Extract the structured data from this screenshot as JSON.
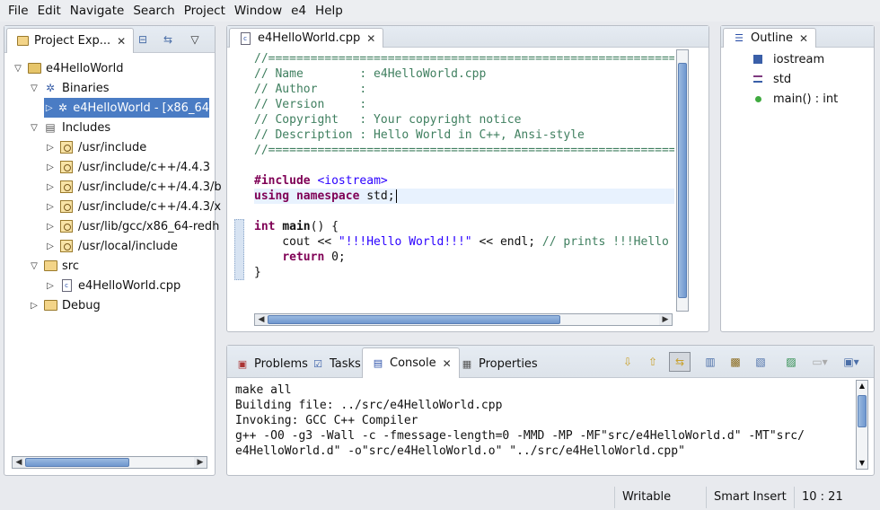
{
  "menu": [
    "File",
    "Edit",
    "Navigate",
    "Search",
    "Project",
    "Window",
    "e4",
    "Help"
  ],
  "project_explorer": {
    "title": "Project Exp...",
    "tree": [
      {
        "label": "e4HelloWorld",
        "depth": 0,
        "twisty": "open",
        "icon": "project-icon"
      },
      {
        "label": "Binaries",
        "depth": 1,
        "twisty": "open",
        "icon": "binaries-icon"
      },
      {
        "label": "e4HelloWorld - [x86_64",
        "depth": 2,
        "twisty": "closed",
        "icon": "binary-icon",
        "selected": true
      },
      {
        "label": "Includes",
        "depth": 1,
        "twisty": "open",
        "icon": "includes-icon"
      },
      {
        "label": "/usr/include",
        "depth": 2,
        "twisty": "closed",
        "icon": "include-folder-icon"
      },
      {
        "label": "/usr/include/c++/4.4.3",
        "depth": 2,
        "twisty": "closed",
        "icon": "include-folder-icon"
      },
      {
        "label": "/usr/include/c++/4.4.3/b",
        "depth": 2,
        "twisty": "closed",
        "icon": "include-folder-icon"
      },
      {
        "label": "/usr/include/c++/4.4.3/x",
        "depth": 2,
        "twisty": "closed",
        "icon": "include-folder-icon"
      },
      {
        "label": "/usr/lib/gcc/x86_64-redh",
        "depth": 2,
        "twisty": "closed",
        "icon": "include-folder-icon"
      },
      {
        "label": "/usr/local/include",
        "depth": 2,
        "twisty": "closed",
        "icon": "include-folder-icon"
      },
      {
        "label": "src",
        "depth": 1,
        "twisty": "open",
        "icon": "source-folder-icon"
      },
      {
        "label": "e4HelloWorld.cpp",
        "depth": 2,
        "twisty": "closed",
        "icon": "cpp-file-icon"
      },
      {
        "label": "Debug",
        "depth": 1,
        "twisty": "closed",
        "icon": "folder-icon"
      }
    ]
  },
  "editor": {
    "tab_label": "e4HelloWorld.cpp",
    "lines": [
      {
        "parts": [
          {
            "t": "//=======================================================================",
            "c": "cm"
          }
        ]
      },
      {
        "parts": [
          {
            "t": "// Name        : e4HelloWorld.cpp",
            "c": "cm"
          }
        ]
      },
      {
        "parts": [
          {
            "t": "// Author      :",
            "c": "cm"
          }
        ]
      },
      {
        "parts": [
          {
            "t": "// Version     :",
            "c": "cm"
          }
        ]
      },
      {
        "parts": [
          {
            "t": "// Copyright   : Your copyright notice",
            "c": "cm"
          }
        ]
      },
      {
        "parts": [
          {
            "t": "// Description : Hello World in C++, Ansi-style",
            "c": "cm"
          }
        ]
      },
      {
        "parts": [
          {
            "t": "//=======================================================================",
            "c": "cm"
          }
        ]
      },
      {
        "parts": []
      },
      {
        "parts": [
          {
            "t": "#include ",
            "c": "kw"
          },
          {
            "t": "<iostream>",
            "c": "str"
          }
        ]
      },
      {
        "parts": [
          {
            "t": "using namespace",
            "c": "kw"
          },
          {
            "t": " std;",
            "c": ""
          }
        ],
        "current": true
      },
      {
        "parts": []
      },
      {
        "parts": [
          {
            "t": "int",
            "c": "kw"
          },
          {
            "t": " ",
            "c": ""
          },
          {
            "t": "main",
            "c": "b"
          },
          {
            "t": "() {",
            "c": ""
          }
        ]
      },
      {
        "parts": [
          {
            "t": "    cout << ",
            "c": ""
          },
          {
            "t": "\"!!!Hello World!!!\"",
            "c": "str"
          },
          {
            "t": " << endl; ",
            "c": ""
          },
          {
            "t": "// prints !!!Hello World!!!",
            "c": "cm"
          }
        ]
      },
      {
        "parts": [
          {
            "t": "    ",
            "c": ""
          },
          {
            "t": "return",
            "c": "kw"
          },
          {
            "t": " 0;",
            "c": ""
          }
        ]
      },
      {
        "parts": [
          {
            "t": "}",
            "c": ""
          }
        ]
      }
    ]
  },
  "outline": {
    "title": "Outline",
    "items": [
      {
        "label": "iostream",
        "icon": "include-icon"
      },
      {
        "label": "std",
        "icon": "namespace-icon"
      },
      {
        "label": "main() : int",
        "icon": "function-icon"
      }
    ]
  },
  "console": {
    "tabs": [
      {
        "label": "Problems",
        "icon": "problems-icon"
      },
      {
        "label": "Tasks",
        "icon": "tasks-icon"
      },
      {
        "label": "Console",
        "icon": "console-icon",
        "active": true
      },
      {
        "label": "Properties",
        "icon": "properties-icon"
      }
    ],
    "lines": [
      "",
      "make all",
      "Building file: ../src/e4HelloWorld.cpp",
      "Invoking: GCC C++ Compiler",
      "g++ -O0 -g3 -Wall -c -fmessage-length=0 -MMD -MP -MF\"src/e4HelloWorld.d\" -MT\"src/",
      "e4HelloWorld.d\" -o\"src/e4HelloWorld.o\" \"../src/e4HelloWorld.cpp\""
    ]
  },
  "status": {
    "writable": "Writable",
    "insert_mode": "Smart Insert",
    "position": "10 : 21"
  },
  "colors": {
    "selection": "#4a7cc4",
    "comment": "#3f7f5f",
    "keyword": "#7f0055",
    "string": "#2a00ff"
  }
}
